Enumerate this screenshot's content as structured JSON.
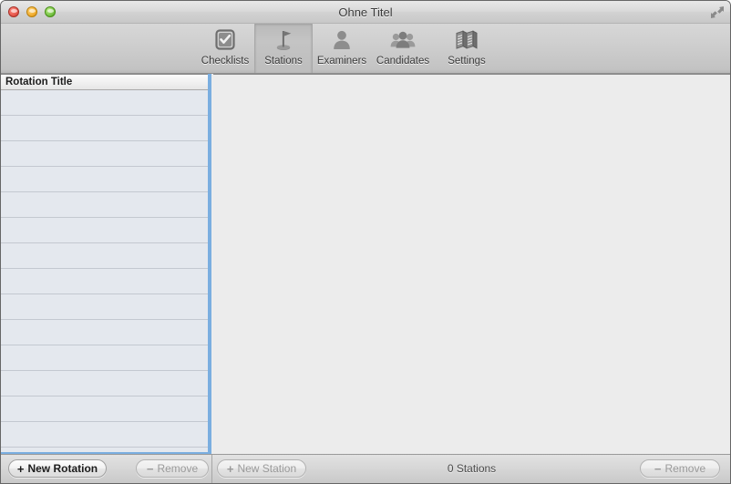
{
  "window": {
    "title": "Ohne Titel",
    "traffic_lights": [
      "close",
      "minimize",
      "zoom"
    ],
    "fullscreen_icon": "fullscreen-arrows-icon"
  },
  "toolbar": {
    "items": [
      {
        "id": "checklists",
        "label": "Checklists",
        "icon": "checkmark-square-icon",
        "selected": false
      },
      {
        "id": "stations",
        "label": "Stations",
        "icon": "flag-icon",
        "selected": true
      },
      {
        "id": "examiners",
        "label": "Examiners",
        "icon": "person-icon",
        "selected": false
      },
      {
        "id": "candidates",
        "label": "Candidates",
        "icon": "people-group-icon",
        "selected": false
      },
      {
        "id": "settings",
        "label": "Settings",
        "icon": "folding-screen-icon",
        "selected": false
      }
    ]
  },
  "sidebar": {
    "column_header": "Rotation Title",
    "rows": [
      "",
      "",
      "",
      "",
      "",
      "",
      "",
      "",
      "",
      "",
      "",
      "",
      "",
      ""
    ],
    "focus_ring_color": "#7aaee0",
    "row_background": "#e4e8ee"
  },
  "detail": {
    "content": ""
  },
  "bottom_bar": {
    "new_rotation": {
      "sign": "+",
      "label": "New Rotation",
      "enabled": true
    },
    "remove_rotation": {
      "sign": "−",
      "label": "Remove",
      "enabled": false
    },
    "new_station": {
      "sign": "+",
      "label": "New Station",
      "enabled": false
    },
    "remove_station": {
      "sign": "−",
      "label": "Remove",
      "enabled": false
    },
    "status": "0 Stations"
  }
}
